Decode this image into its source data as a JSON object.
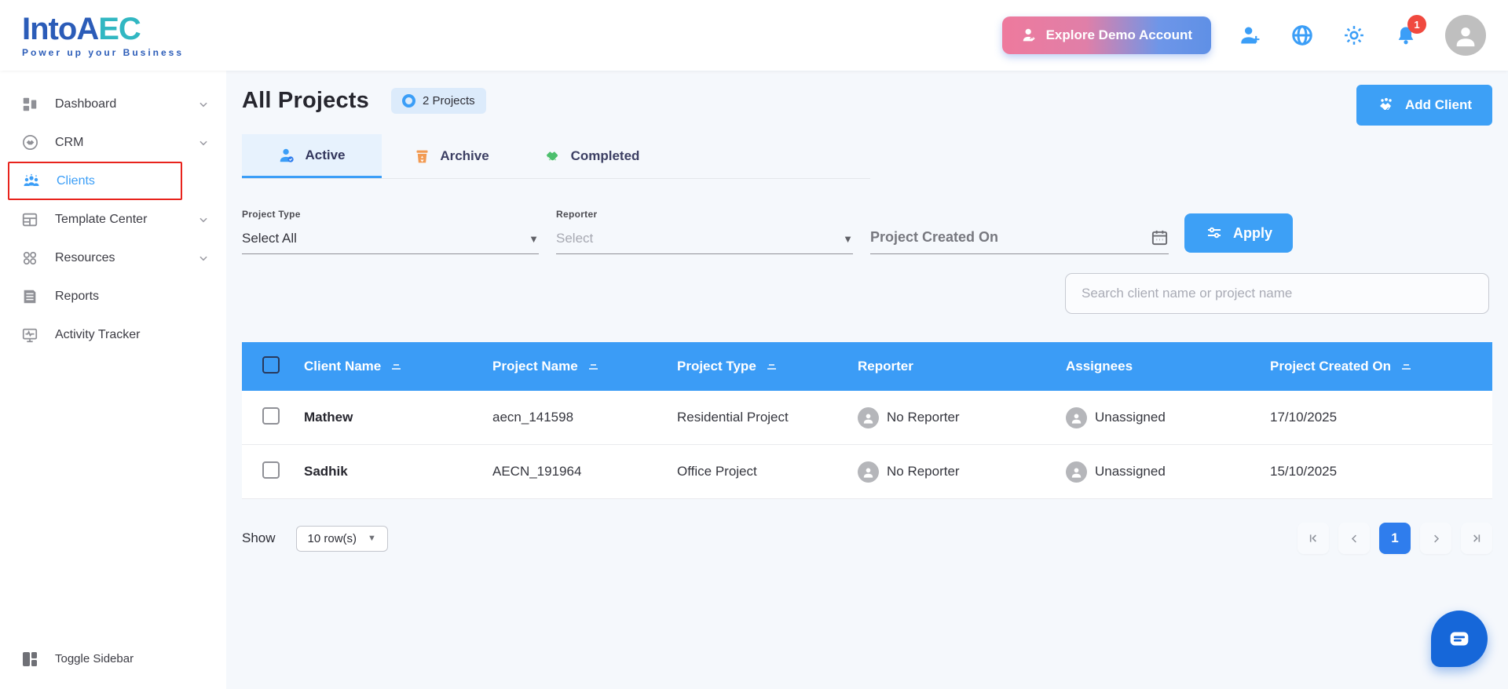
{
  "header": {
    "logo": {
      "into": "Into",
      "a": "A",
      "ec": "EC",
      "tagline": "Power up your Business"
    },
    "explore_demo_button": "Explore Demo Account",
    "notification_count": "1"
  },
  "sidebar": {
    "items": [
      {
        "label": "Dashboard"
      },
      {
        "label": "CRM"
      },
      {
        "label": "Clients"
      },
      {
        "label": "Template Center"
      },
      {
        "label": "Resources"
      },
      {
        "label": "Reports"
      },
      {
        "label": "Activity Tracker"
      }
    ],
    "toggle_label": "Toggle Sidebar"
  },
  "main": {
    "title": "All Projects",
    "projects_badge": "2 Projects",
    "add_client_button": "Add Client",
    "tabs": [
      {
        "label": "Active"
      },
      {
        "label": "Archive"
      },
      {
        "label": "Completed"
      }
    ],
    "filters": {
      "project_type": {
        "label": "Project Type",
        "value": "Select All"
      },
      "reporter": {
        "label": "Reporter",
        "placeholder": "Select"
      },
      "created_on": {
        "placeholder": "Project Created On"
      },
      "apply_button": "Apply"
    },
    "search_placeholder": "Search client name or project name",
    "table": {
      "columns": [
        "Client Name",
        "Project Name",
        "Project Type",
        "Reporter",
        "Assignees",
        "Project Created On"
      ],
      "rows": [
        {
          "client": "Mathew",
          "project": "aecn_141598",
          "type": "Residential Project",
          "reporter": "No Reporter",
          "assignees": "Unassigned",
          "created": "17/10/2025"
        },
        {
          "client": "Sadhik",
          "project": "AECN_191964",
          "type": "Office Project",
          "reporter": "No Reporter",
          "assignees": "Unassigned",
          "created": "15/10/2025"
        }
      ]
    },
    "pagination": {
      "show_label": "Show",
      "rows_select": "10 row(s)",
      "current_page": "1"
    }
  },
  "colors": {
    "accent_blue": "#3b9ef7",
    "table_header": "#3b9cf6",
    "active_page": "#2f7ded",
    "highlight_red": "#e8231c",
    "badge_red": "#f0493f",
    "chat_blue": "#1667d9",
    "demo_gradient_start": "#ee7a9d",
    "demo_gradient_end": "#5f90e6"
  }
}
